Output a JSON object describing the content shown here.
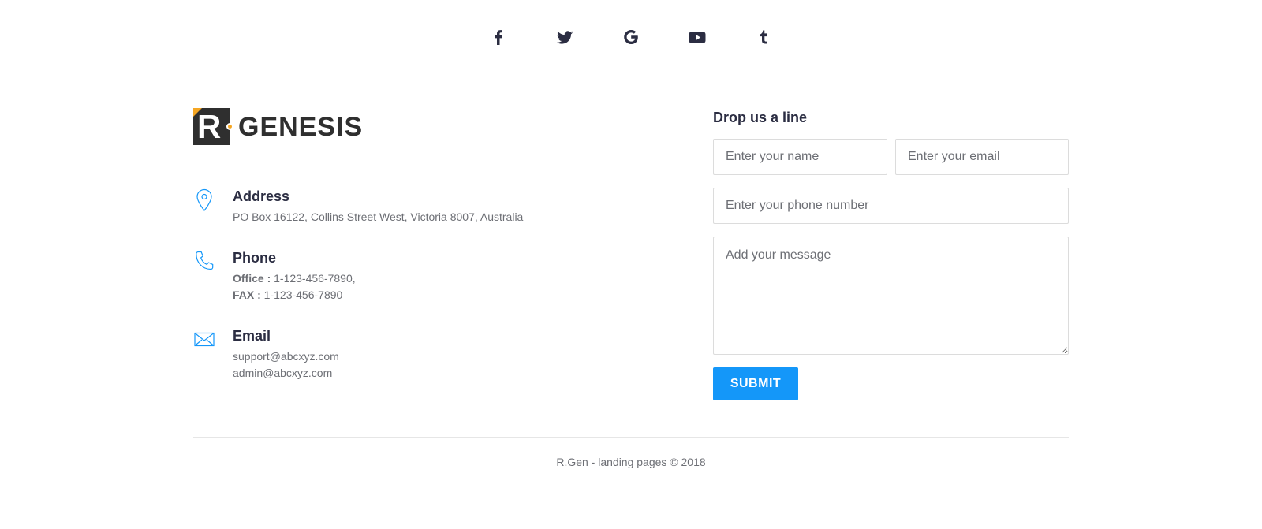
{
  "social": [
    {
      "icon": "facebook-icon"
    },
    {
      "icon": "twitter-icon"
    },
    {
      "icon": "google-icon"
    },
    {
      "icon": "youtube-icon"
    },
    {
      "icon": "tumblr-icon"
    }
  ],
  "logo": {
    "mark": "R",
    "text": "GENESIS",
    "accent": "#f5a623"
  },
  "contact": {
    "address": {
      "icon": "map-pin-icon",
      "title": "Address",
      "line": "PO Box 16122, Collins Street West, Victoria 8007, Australia"
    },
    "phone": {
      "icon": "phone-icon",
      "title": "Phone",
      "office_label": "Office :",
      "office_value": " 1-123-456-7890,",
      "fax_label": "FAX :",
      "fax_value": " 1-123-456-7890"
    },
    "email": {
      "icon": "envelope-icon",
      "title": "Email",
      "lines": [
        "support@abcxyz.com",
        "admin@abcxyz.com"
      ]
    }
  },
  "form": {
    "title": "Drop us a line",
    "name_placeholder": "Enter your name",
    "email_placeholder": "Enter your email",
    "phone_placeholder": "Enter your phone number",
    "message_placeholder": "Add your message",
    "submit_label": "SUBMIT",
    "accent": "#1497f9"
  },
  "footer": {
    "copyright": "R.Gen - landing pages © 2018"
  }
}
